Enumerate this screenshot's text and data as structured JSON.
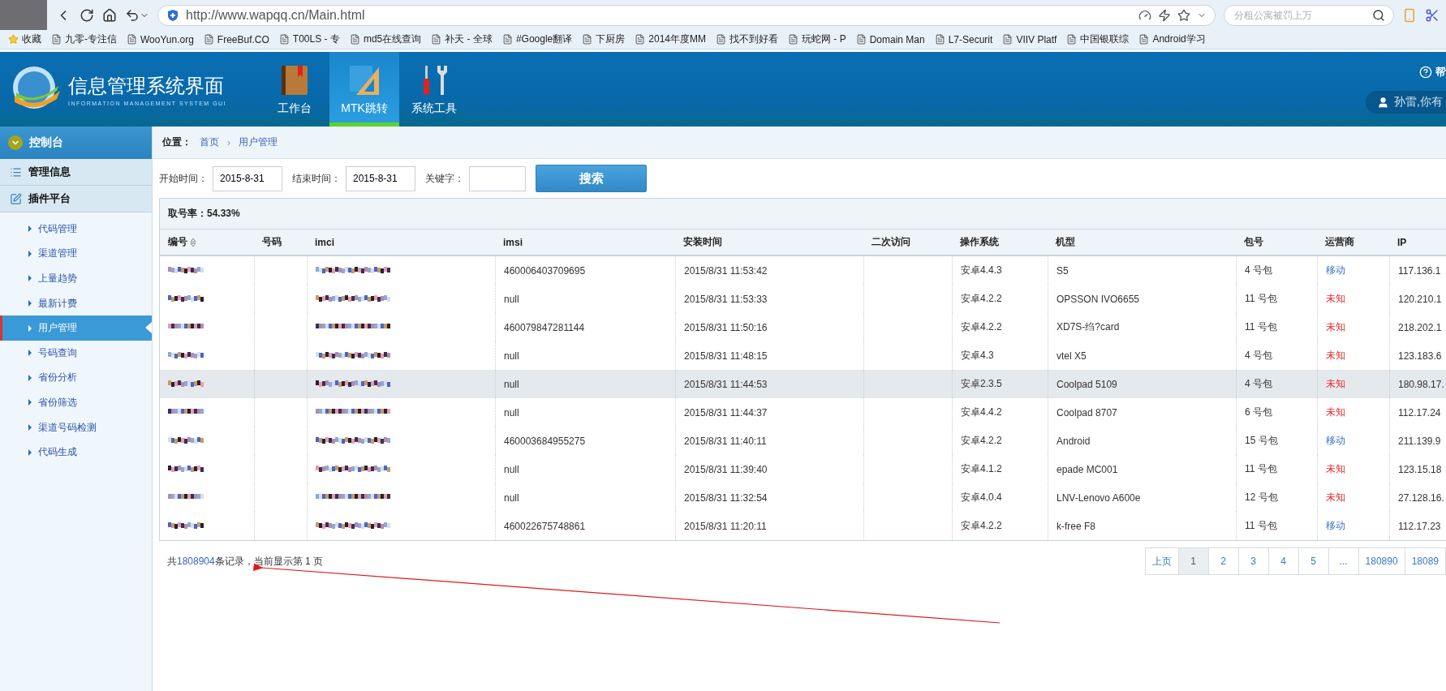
{
  "browser": {
    "url": "http://www.wapqq.cn/Main.html",
    "search_placeholder": "分租公寓被罚上万",
    "bookmarks": [
      "收藏",
      "九零-专注信",
      "WooYun.org",
      "FreeBuf.CO",
      "T00LS - 专",
      "md5在线查询",
      "补天 - 全球",
      "#Google翻译",
      "下厨房",
      "2014年度MM",
      "找不到好看",
      "玩蛇网 - P",
      "Domain Man",
      "L7-Securit",
      "VIIV Platf",
      "中国银联综",
      "Android学习"
    ]
  },
  "header": {
    "title": "信息管理系统界面",
    "subtitle": "INFORMATION MANAGEMENT SYSTEM GUI",
    "tabs": [
      {
        "label": "工作台",
        "selected": false
      },
      {
        "label": "MTK跳转",
        "selected": true
      },
      {
        "label": "系统工具",
        "selected": false
      }
    ],
    "help": "帮",
    "user": "孙雷,你有"
  },
  "sidebar": {
    "title": "控制台",
    "sections": [
      {
        "label": "管理信息"
      },
      {
        "label": "插件平台"
      }
    ],
    "items": [
      {
        "label": "代码管理",
        "selected": false
      },
      {
        "label": "渠道管理",
        "selected": false
      },
      {
        "label": "上量趋势",
        "selected": false
      },
      {
        "label": "最新计费",
        "selected": false
      },
      {
        "label": "用户管理",
        "selected": true
      },
      {
        "label": "号码查询",
        "selected": false
      },
      {
        "label": "省份分析",
        "selected": false
      },
      {
        "label": "省份筛选",
        "selected": false
      },
      {
        "label": "渠道号码检测",
        "selected": false
      },
      {
        "label": "代码生成",
        "selected": false
      }
    ]
  },
  "breadcrumb": {
    "label": "位置：",
    "separator": "›",
    "items": [
      "首页",
      "用户管理"
    ]
  },
  "search": {
    "start_label": "开始时间：",
    "start_value": "2015-8-31",
    "end_label": "结束时间：",
    "end_value": "2015-8-31",
    "keyword_label": "关键字：",
    "button": "搜索"
  },
  "rate": "取号率：54.33%",
  "table": {
    "columns": [
      "编号",
      "号码",
      "imci",
      "imsi",
      "安装时间",
      "二次访问",
      "操作系统",
      "机型",
      "包号",
      "运营商",
      "IP"
    ],
    "rows": [
      {
        "redacted": true,
        "imsi": "460006403709695",
        "time": "2015/8/31 11:53:42",
        "os": "安卓4.4.3",
        "model": "S5",
        "package": "4 号包",
        "carrier": {
          "text": "移动",
          "color": "#3b73c8"
        },
        "ip": "117.136.1",
        "highlighted": false
      },
      {
        "redacted": true,
        "imsi": "null",
        "time": "2015/8/31 11:53:33",
        "os": "安卓4.2.2",
        "model": "OPSSON IVO6655",
        "package": "11 号包",
        "carrier": {
          "text": "未知",
          "color": "#e8282a"
        },
        "ip": "120.210.1",
        "highlighted": false
      },
      {
        "redacted": true,
        "imsi": "460079847281144",
        "time": "2015/8/31 11:50:16",
        "os": "安卓4.2.2",
        "model": "XD7S-绉?card",
        "package": "11 号包",
        "carrier": {
          "text": "未知",
          "color": "#e8282a"
        },
        "ip": "218.202.1",
        "highlighted": false
      },
      {
        "redacted": true,
        "imsi": "null",
        "time": "2015/8/31 11:48:15",
        "os": "安卓4.3",
        "model": "vtel X5",
        "package": "4 号包",
        "carrier": {
          "text": "未知",
          "color": "#e8282a"
        },
        "ip": "123.183.6",
        "highlighted": false
      },
      {
        "redacted": true,
        "imsi": "null",
        "time": "2015/8/31 11:44:53",
        "os": "安卓2.3.5",
        "model": "Coolpad 5109",
        "package": "4 号包",
        "carrier": {
          "text": "未知",
          "color": "#e8282a"
        },
        "ip": "180.98.17.",
        "highlighted": true
      },
      {
        "redacted": true,
        "imsi": "null",
        "time": "2015/8/31 11:44:37",
        "os": "安卓4.4.2",
        "model": "Coolpad 8707",
        "package": "6 号包",
        "carrier": {
          "text": "未知",
          "color": "#e8282a"
        },
        "ip": "112.17.24",
        "highlighted": false
      },
      {
        "redacted": true,
        "imsi": "460003684955275",
        "time": "2015/8/31 11:40:11",
        "os": "安卓4.2.2",
        "model": "Android",
        "package": "15 号包",
        "carrier": {
          "text": "移动",
          "color": "#3b73c8"
        },
        "ip": "211.139.9",
        "highlighted": false
      },
      {
        "redacted": true,
        "imsi": "null",
        "time": "2015/8/31 11:39:40",
        "os": "安卓4.1.2",
        "model": "epade MC001",
        "package": "11 号包",
        "carrier": {
          "text": "未知",
          "color": "#e8282a"
        },
        "ip": "123.15.18",
        "highlighted": false
      },
      {
        "redacted": true,
        "imsi": "null",
        "time": "2015/8/31 11:32:54",
        "os": "安卓4.0.4",
        "model": "LNV-Lenovo A600e",
        "package": "12 号包",
        "carrier": {
          "text": "未知",
          "color": "#e8282a"
        },
        "ip": "27.128.16.",
        "highlighted": false
      },
      {
        "redacted": true,
        "imsi": "460022675748861",
        "time": "2015/8/31 11:20:11",
        "os": "安卓4.2.2",
        "model": "k-free F8",
        "package": "11 号包",
        "carrier": {
          "text": "移动",
          "color": "#3b73c8"
        },
        "ip": "112.17.23",
        "highlighted": false
      }
    ]
  },
  "footer": {
    "prefix": "共",
    "count": "1808904",
    "suffix": "条记录，当前显示第 1 页"
  },
  "pagination": [
    {
      "label": "上页",
      "selected": false
    },
    {
      "label": "1",
      "selected": true
    },
    {
      "label": "2",
      "selected": false
    },
    {
      "label": "3",
      "selected": false
    },
    {
      "label": "4",
      "selected": false
    },
    {
      "label": "5",
      "selected": false
    },
    {
      "label": "...",
      "selected": false
    },
    {
      "label": "180890",
      "selected": false
    },
    {
      "label": "18089",
      "selected": false
    }
  ]
}
